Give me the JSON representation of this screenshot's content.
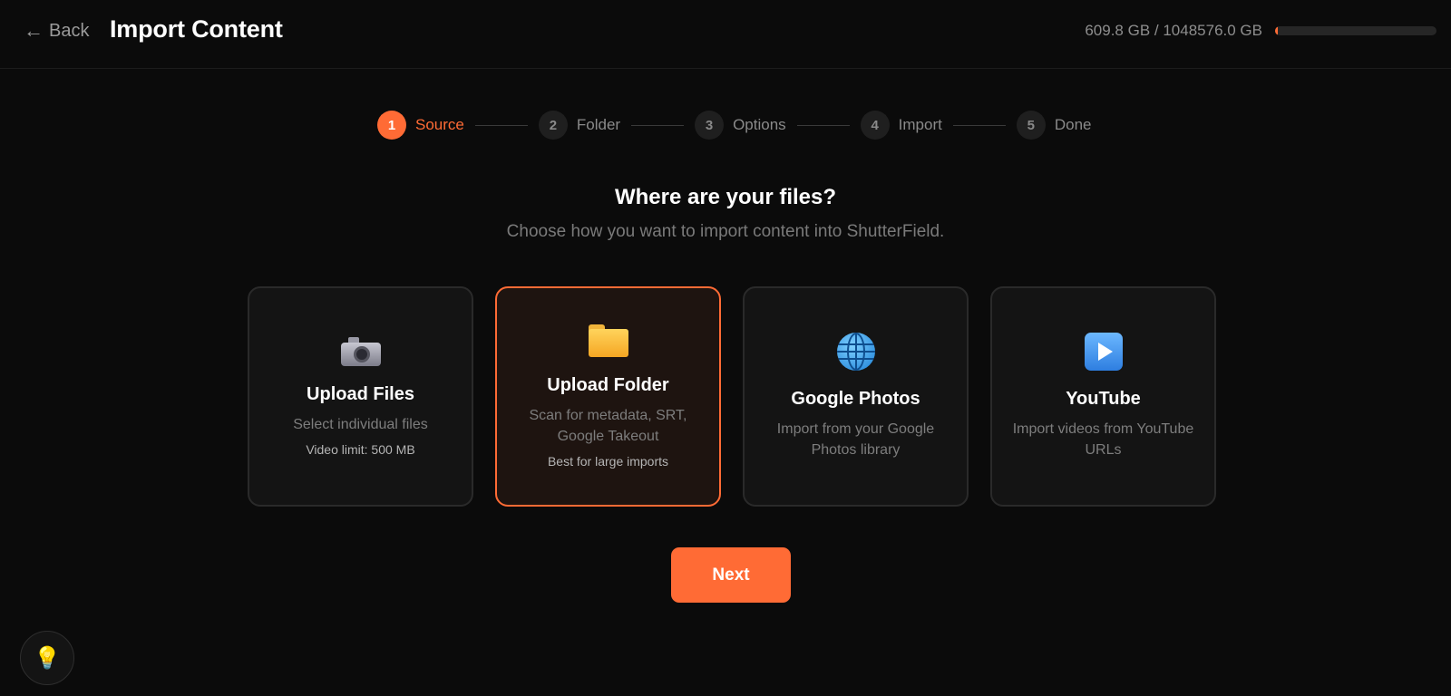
{
  "header": {
    "back_label": "Back",
    "title": "Import Content",
    "storage_text": "609.8 GB / 1048576.0 GB",
    "storage_used_fraction": 0.0006
  },
  "stepper": {
    "steps": [
      {
        "num": "1",
        "label": "Source"
      },
      {
        "num": "2",
        "label": "Folder"
      },
      {
        "num": "3",
        "label": "Options"
      },
      {
        "num": "4",
        "label": "Import"
      },
      {
        "num": "5",
        "label": "Done"
      }
    ],
    "active_step": 1
  },
  "main": {
    "heading": "Where are your files?",
    "subheading": "Choose how you want to import content into ShutterField."
  },
  "cards": [
    {
      "icon": "camera-icon",
      "title": "Upload Files",
      "desc": "Select individual files",
      "note": "Video limit: 500 MB"
    },
    {
      "icon": "folder-icon",
      "title": "Upload Folder",
      "desc": "Scan for metadata, SRT, Google Takeout",
      "note": "Best for large imports"
    },
    {
      "icon": "globe-icon",
      "title": "Google Photos",
      "desc": "Import from your Google Photos library",
      "note": ""
    },
    {
      "icon": "play-icon",
      "title": "YouTube",
      "desc": "Import videos from YouTube URLs",
      "note": ""
    }
  ],
  "selected_card": 1,
  "next_label": "Next",
  "colors": {
    "accent": "#ff6b35",
    "background": "#0b0b0b"
  },
  "tips_icon": "lightbulb-icon"
}
